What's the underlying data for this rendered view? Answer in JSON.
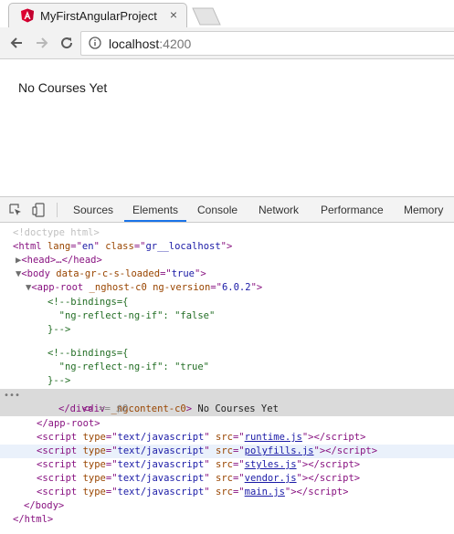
{
  "browser": {
    "tab": {
      "title": "MyFirstAngularProject",
      "close": "×"
    },
    "url_host": "localhost",
    "url_port": ":4200"
  },
  "page": {
    "message": "No Courses Yet"
  },
  "devtools": {
    "tabs": [
      {
        "label": "Sources",
        "active": false
      },
      {
        "label": "Elements",
        "active": true
      },
      {
        "label": "Console",
        "active": false
      },
      {
        "label": "Network",
        "active": false
      },
      {
        "label": "Performance",
        "active": false
      },
      {
        "label": "Memory",
        "active": false
      }
    ],
    "dom": {
      "doctype": "<!doctype html>",
      "html_open": {
        "tag": "html",
        "attr": "lang",
        "val": "en",
        "attr2": "class",
        "val2": "gr__localhost"
      },
      "head": "<head>…</head>",
      "body_attr": "data-gr-c-s-loaded",
      "body_val": "true",
      "app_root_attr": "_nghost-c0",
      "app_root_attr2": "ng-version",
      "app_root_val2": "6.0.2",
      "comment1": [
        "<!--bindings={",
        "  \"ng-reflect-ng-if\": \"false\"",
        "}-->"
      ],
      "comment2": [
        "<!--bindings={",
        "  \"ng-reflect-ng-if\": \"true\"",
        "}-->"
      ],
      "div_attr": "_ngcontent-c0",
      "div_text": "No Courses Yet",
      "div_close": "</div>",
      "ref": "== $0",
      "app_root_close": "</app-root>",
      "scripts": [
        {
          "type": "text/javascript",
          "src": "runtime.js"
        },
        {
          "type": "text/javascript",
          "src": "polyfills.js"
        },
        {
          "type": "text/javascript",
          "src": "styles.js"
        },
        {
          "type": "text/javascript",
          "src": "vendor.js"
        },
        {
          "type": "text/javascript",
          "src": "main.js"
        }
      ],
      "body_close": "</body>",
      "html_close": "</html>"
    }
  },
  "colors": {
    "accent": "#1a73e8",
    "angular_red": "#dd0031"
  },
  "icons": [
    "angular-logo-icon",
    "back-arrow-icon",
    "forward-arrow-icon",
    "reload-icon",
    "info-icon",
    "inspect-element-icon",
    "device-toolbar-icon"
  ]
}
